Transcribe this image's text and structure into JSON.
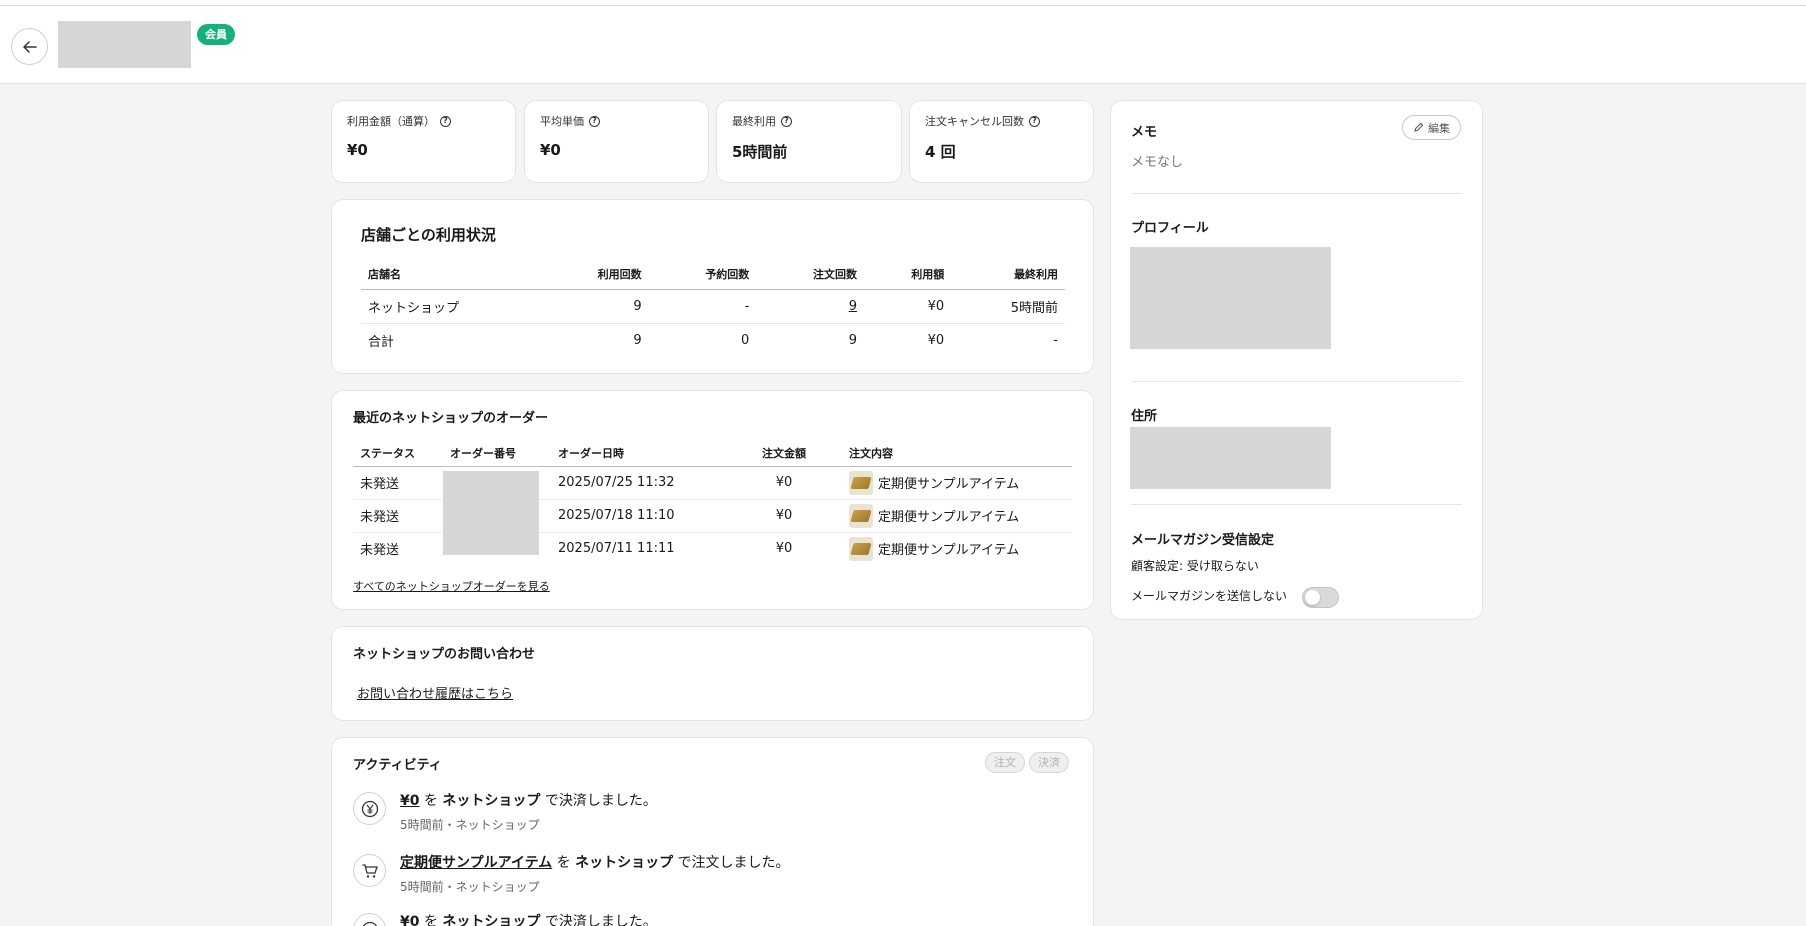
{
  "header": {
    "member_badge": "会員"
  },
  "stats": [
    {
      "label": "利用金額（通算）",
      "value": "¥0"
    },
    {
      "label": "平均単価",
      "value": "¥0"
    },
    {
      "label": "最終利用",
      "value": "5時間前"
    },
    {
      "label": "注文キャンセル回数",
      "value": "4 回"
    }
  ],
  "store_usage": {
    "title": "店舗ごとの利用状況",
    "columns": [
      "店舗名",
      "利用回数",
      "予約回数",
      "注文回数",
      "利用額",
      "最終利用"
    ],
    "rows": [
      {
        "name": "ネットショップ",
        "use_count": "9",
        "reserve_count": "-",
        "order_count": "9",
        "amount": "¥0",
        "last_use": "5時間前"
      },
      {
        "name": "合計",
        "use_count": "9",
        "reserve_count": "0",
        "order_count": "9",
        "amount": "¥0",
        "last_use": "-"
      }
    ]
  },
  "orders": {
    "title": "最近のネットショップのオーダー",
    "columns": [
      "ステータス",
      "オーダー番号",
      "オーダー日時",
      "注文金額",
      "注文内容"
    ],
    "rows": [
      {
        "status": "未発送",
        "datetime": "2025/07/25 11:32",
        "amount": "¥0",
        "item": "定期便サンプルアイテム"
      },
      {
        "status": "未発送",
        "datetime": "2025/07/18 11:10",
        "amount": "¥0",
        "item": "定期便サンプルアイテム"
      },
      {
        "status": "未発送",
        "datetime": "2025/07/11 11:11",
        "amount": "¥0",
        "item": "定期便サンプルアイテム"
      }
    ],
    "view_all_link": "すべてのネットショップオーダーを見る"
  },
  "inquiry": {
    "title": "ネットショップのお問い合わせ",
    "link": "お問い合わせ履歴はこちら"
  },
  "activity": {
    "title": "アクティビティ",
    "filters": [
      "注文",
      "決済"
    ],
    "items": [
      {
        "icon": "yen-icon",
        "subject": "¥0",
        "particle": " を ",
        "store": "ネットショップ",
        "action": " で決済しました。",
        "meta": "5時間前・ネットショップ"
      },
      {
        "icon": "cart-icon",
        "subject": "定期便サンプルアイテム",
        "particle": " を ",
        "store": "ネットショップ",
        "action": " で注文しました。",
        "meta": "5時間前・ネットショップ"
      },
      {
        "icon": "yen-icon",
        "subject": "¥0",
        "particle": " を ",
        "store": "ネットショップ",
        "action": " で決済しました。",
        "meta": ""
      }
    ]
  },
  "sidebar": {
    "memo_title": "メモ",
    "edit_label": "編集",
    "memo_empty": "メモなし",
    "profile_title": "プロフィール",
    "address_title": "住所",
    "newsletter_title": "メールマガジン受信設定",
    "customer_setting": "顧客設定: 受け取らない",
    "send_toggle_label": "メールマガジンを送信しない",
    "send_toggle_on": false
  },
  "colors": {
    "badge": "#15b179",
    "background": "#f4f4f2",
    "placeholder": "#d6d6d6"
  }
}
